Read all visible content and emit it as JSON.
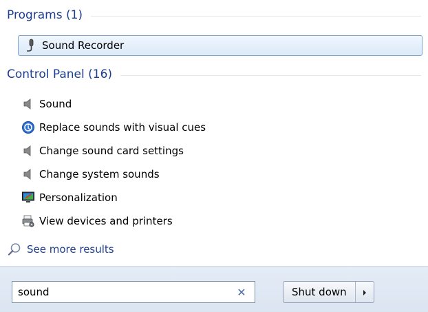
{
  "sections": {
    "programs": {
      "title": "Programs (1)",
      "items": [
        {
          "label": "Sound Recorder",
          "icon": "microphone-icon",
          "selected": true
        }
      ]
    },
    "control_panel": {
      "title": "Control Panel (16)",
      "items": [
        {
          "label": "Sound",
          "icon": "speaker-icon"
        },
        {
          "label": "Replace sounds with visual cues",
          "icon": "ease-of-access-icon"
        },
        {
          "label": "Change sound card settings",
          "icon": "speaker-icon"
        },
        {
          "label": "Change system sounds",
          "icon": "speaker-icon"
        },
        {
          "label": "Personalization",
          "icon": "personalization-icon"
        },
        {
          "label": "View devices and printers",
          "icon": "devices-printers-icon"
        }
      ]
    }
  },
  "see_more": {
    "label": "See more results",
    "icon": "search-icon"
  },
  "search": {
    "value": "sound",
    "clear_icon": "close-icon"
  },
  "shutdown": {
    "label": "Shut down",
    "arrow_icon": "chevron-right-icon"
  },
  "colors": {
    "section_title": "#1e3e91",
    "link": "#1e3e91",
    "selected_border": "#7da2ce",
    "bottom_bar": "#dbe5f1"
  }
}
